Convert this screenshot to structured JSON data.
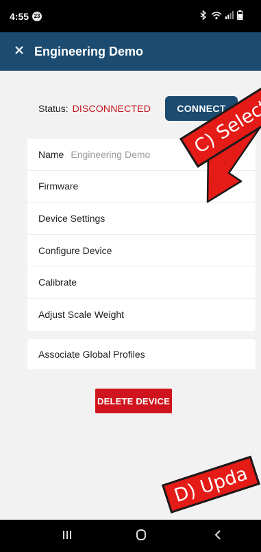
{
  "status_bar": {
    "time": "4:55",
    "notification_count": "23",
    "icons": [
      "bluetooth-icon",
      "wifi-icon",
      "signal-icon",
      "battery-icon"
    ]
  },
  "app_bar": {
    "close_icon": "close-icon",
    "title": "Engineering Demo",
    "color": "#1b4b70"
  },
  "connection": {
    "status_label": "Status:",
    "status_value": "DISCONNECTED",
    "status_color": "#c4161c",
    "connect_label": "CONNECT"
  },
  "device": {
    "name_label": "Name",
    "name_value": "Engineering Demo"
  },
  "menu_items": [
    "Firmware",
    "Device Settings",
    "Configure Device",
    "Calibrate",
    "Adjust Scale Weight"
  ],
  "associate_label": "Associate Global Profiles",
  "delete_label": "DELETE DEVICE",
  "nav_bar": {
    "icons": [
      "recent-apps-icon",
      "home-icon",
      "back-icon"
    ]
  },
  "annotations": {
    "step_c": "C) Select Fi",
    "step_d": "D) Upda",
    "color": "#e41b17"
  }
}
